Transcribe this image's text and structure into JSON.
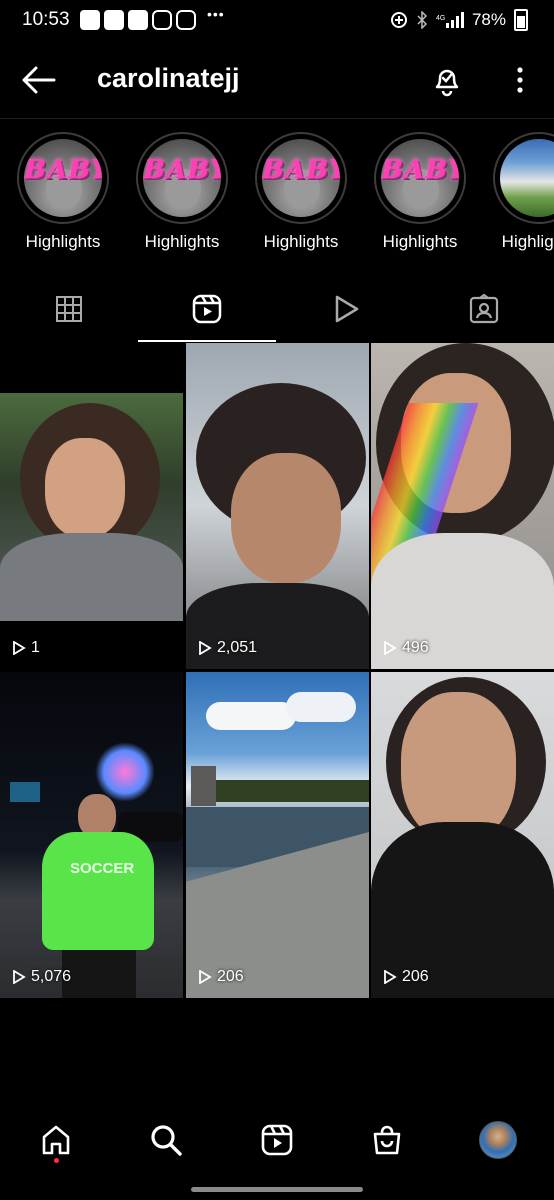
{
  "status_bar": {
    "time": "10:53",
    "overflow_dots": "•••",
    "battery": "78%"
  },
  "header": {
    "username": "carolinatejj",
    "back_icon": "arrow-left-icon",
    "bell_icon": "notification-bell-icon",
    "menu_icon": "more-vertical-icon"
  },
  "highlights": [
    {
      "label": "Highlights",
      "cover_text": "BABY"
    },
    {
      "label": "Highlights",
      "cover_text": "BABY"
    },
    {
      "label": "Highlights",
      "cover_text": "BABY"
    },
    {
      "label": "Highlights",
      "cover_text": "BABY"
    },
    {
      "label": "Highlights",
      "cover_text": ""
    }
  ],
  "tabs": [
    {
      "icon": "grid-icon",
      "active": false
    },
    {
      "icon": "reels-icon",
      "active": true
    },
    {
      "icon": "play-icon",
      "active": false
    },
    {
      "icon": "tagged-icon",
      "active": false
    }
  ],
  "reels": [
    {
      "views": "1"
    },
    {
      "views": "2,051"
    },
    {
      "views": "496"
    },
    {
      "views": "5,076"
    },
    {
      "views": "206"
    },
    {
      "views": "206"
    }
  ],
  "reel_cover_texts": {
    "shirt_text": "SOCCER"
  },
  "bottom_nav": [
    {
      "icon": "home-icon"
    },
    {
      "icon": "search-icon"
    },
    {
      "icon": "reels-icon"
    },
    {
      "icon": "shop-icon"
    },
    {
      "icon": "profile-avatar"
    }
  ],
  "colors": {
    "background": "#000000",
    "text": "#ffffff",
    "notification_dot": "#ff3040",
    "highlight_text": "#ff3fb4"
  }
}
